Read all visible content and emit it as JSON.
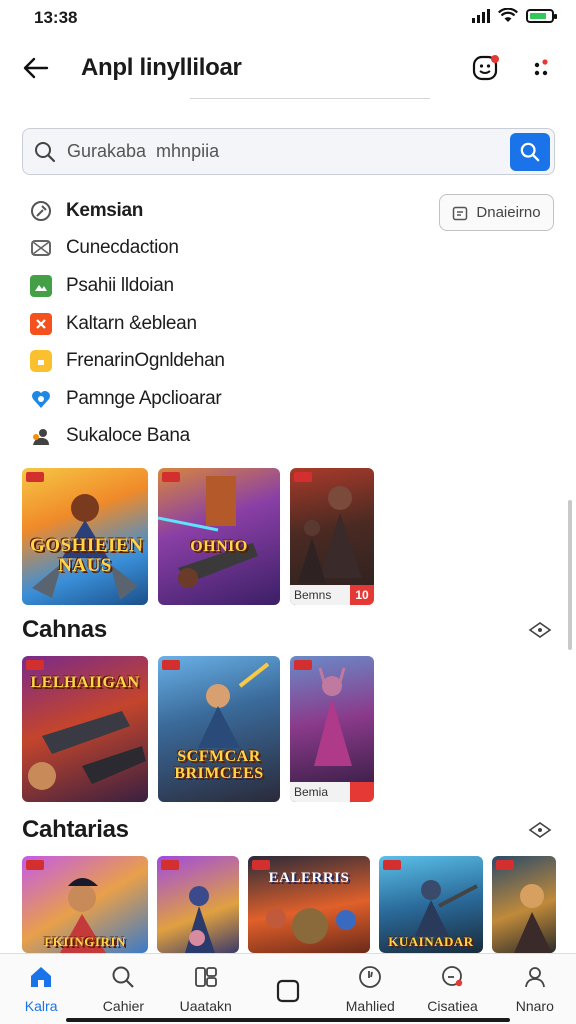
{
  "status_bar": {
    "time": "13:38"
  },
  "header": {
    "title": "Anpl linylliloar"
  },
  "search": {
    "placeholder": "Gurakaba  mhnpiia"
  },
  "filter_button": {
    "label": "Dnaieirno"
  },
  "categories": [
    {
      "label": "Kemsian",
      "icon": "wrench-icon",
      "color": "#555555"
    },
    {
      "label": "Cunecdaction",
      "icon": "mail-icon",
      "color": "#666666"
    },
    {
      "label": "Psahii lldoian",
      "icon": "image-icon",
      "color": "#43a047"
    },
    {
      "label": "Kaltarn &eblean",
      "icon": "x-box-icon",
      "color": "#f4511e"
    },
    {
      "label": "FrenarinOgnldehan",
      "icon": "folder-icon",
      "color": "#fbc02d"
    },
    {
      "label": "Pamnge Apclioarar",
      "icon": "heart-shield-icon",
      "color": "#1e88e5"
    },
    {
      "label": "Sukaloce Bana",
      "icon": "people-icon",
      "color": "#424242"
    }
  ],
  "row1": [
    {
      "title": "GOSHIEIEN\nNAUS"
    },
    {
      "title": "OHNIO"
    },
    {
      "footer": "Bemns",
      "badge": "10"
    }
  ],
  "section1": {
    "title": "Cahnas"
  },
  "row2": [
    {
      "title": "LELHAIIGAN"
    },
    {
      "title": "SCFMCAR\nBRIMCEES"
    },
    {
      "footer": "Bemia",
      "badge": ""
    }
  ],
  "section2": {
    "title": "Cahtarias"
  },
  "row3": [
    {
      "title": "FKIINGIRIN"
    },
    {
      "title": ""
    },
    {
      "title": "EALERRIS"
    },
    {
      "title": "KUAINADAR"
    },
    {
      "title": ""
    }
  ],
  "bottom_nav": [
    {
      "label": "Kalra",
      "icon": "home-icon",
      "active": true
    },
    {
      "label": "Cahier",
      "icon": "search-icon",
      "active": false
    },
    {
      "label": "Uaatakn",
      "icon": "apps-icon",
      "active": false
    },
    {
      "label": "",
      "icon": "square-icon",
      "active": false
    },
    {
      "label": "Mahlied",
      "icon": "clock-icon",
      "active": false
    },
    {
      "label": "Cisatiea",
      "icon": "chat-icon",
      "active": false
    },
    {
      "label": "Nnaro",
      "icon": "profile-icon",
      "active": false
    }
  ],
  "colors": {
    "accent": "#1a73e8",
    "alert": "#e53935"
  }
}
